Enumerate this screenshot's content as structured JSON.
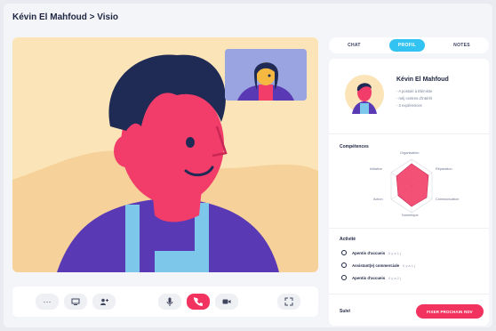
{
  "header": {
    "title": "Kévin El Mahfoud > Visio"
  },
  "tabs": [
    {
      "label": "CHAT"
    },
    {
      "label": "PROFIL"
    },
    {
      "label": "NOTES"
    }
  ],
  "profile": {
    "name": "Kévin El Mahfoud",
    "lines": [
      "- A postulé à Élémiste",
      "- mêj centres d'intérêt",
      "- 3 expériences"
    ]
  },
  "competences": {
    "title": "Compétences",
    "axes": [
      "Organisation",
      "Réparation",
      "Communication",
      "Numérique",
      "Action",
      "Initiative"
    ]
  },
  "activite": {
    "title": "Activité",
    "items": [
      {
        "title": "Apentis d'accueis",
        "meta": "Il y a 1 j"
      },
      {
        "title": "Assistant(e) commerciale",
        "meta": "Il y a 1 j"
      },
      {
        "title": "Apentis d'accueis",
        "meta": "Il y a 2 j"
      }
    ]
  },
  "suivi": {
    "title": "Suivi",
    "button_label": "FIXER PROCHAIN RDV"
  },
  "controls": {
    "more": "···"
  },
  "colors": {
    "accent_blue": "#33c3f2",
    "accent_red": "#f2335f",
    "video_bg": "#fbe5b8"
  }
}
